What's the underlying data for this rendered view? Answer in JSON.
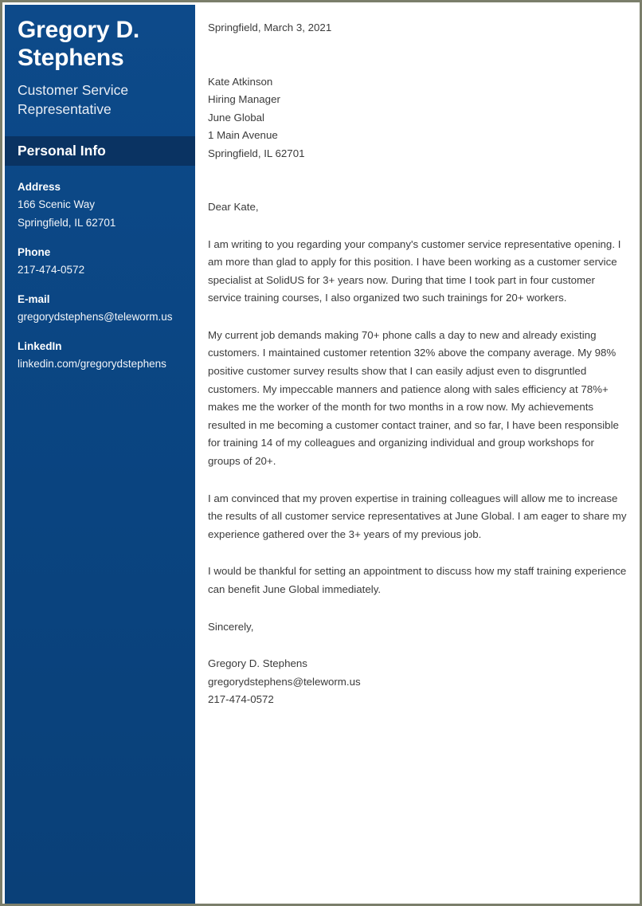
{
  "theme": {
    "sidebar_bg": "#0a4480",
    "sidebar_header_bg": "#0a3362",
    "page_border": "#7b7e6b",
    "body_text": "#3b3b3b",
    "sidebar_text": "#ffffff"
  },
  "sidebar": {
    "full_name": "Gregory D. Stephens",
    "job_title": "Customer Service Representative",
    "section_title": "Personal Info",
    "contacts": [
      {
        "label": "Address",
        "lines": [
          "166 Scenic Way",
          "Springfield, IL 62701"
        ]
      },
      {
        "label": "Phone",
        "lines": [
          "217-474-0572"
        ]
      },
      {
        "label": "E-mail",
        "lines": [
          "gregorydstephens@teleworm.us"
        ]
      },
      {
        "label": "LinkedIn",
        "lines": [
          "linkedin.com/gregorydstephens"
        ]
      }
    ]
  },
  "letter": {
    "date": "Springfield, March 3, 2021",
    "recipient": [
      "Kate Atkinson",
      "Hiring Manager",
      "June Global",
      "1 Main Avenue",
      "Springfield, IL 62701"
    ],
    "salutation": "Dear Kate,",
    "paragraphs": [
      "I am writing to you regarding your company's customer service representative opening. I am more than glad to apply for this position. I have been working as a customer service specialist at SolidUS for 3+ years now. During that time I took part in four customer service training courses, I also organized two such trainings for 20+ workers.",
      "My current job demands making 70+ phone calls a day to new and already existing customers. I maintained customer retention 32% above the company average. My 98% positive customer survey results show that I can easily adjust even to disgruntled customers. My impeccable manners and patience along with sales efficiency at 78%+ makes me the worker of the month for two months in a row now. My achievements resulted in me becoming a customer contact trainer, and so far, I have been responsible for training 14 of my colleagues and organizing individual and group workshops for groups of 20+.",
      "I am convinced that my proven expertise in training colleagues will allow me to increase the results of all customer service representatives at June Global. I am eager to share my experience gathered over the 3+ years of my previous job.",
      "I would be thankful for setting an appointment to discuss how my staff training experience can benefit June Global immediately."
    ],
    "closing": "Sincerely,",
    "signature": [
      "Gregory D. Stephens",
      "gregorydstephens@teleworm.us",
      "217-474-0572"
    ]
  }
}
